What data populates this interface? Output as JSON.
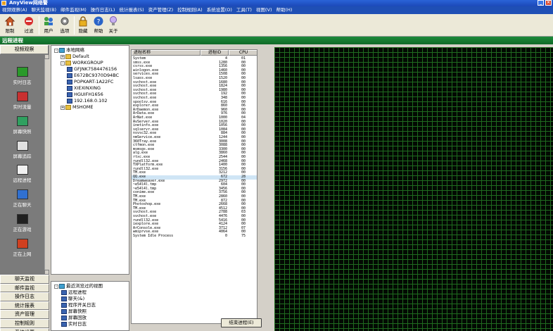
{
  "window": {
    "title": "AnyView网络警",
    "min": "_",
    "close": "×"
  },
  "menu": [
    "视频观察(A)",
    "聊天监视(B)",
    "邮件监视(M)",
    "操作日志(L)",
    "统计报表(S)",
    "资产管理(Z)",
    "控制规则(A)",
    "系统设置(O)",
    "工具(T)",
    "视图(V)",
    "帮助(H)"
  ],
  "toolbar": [
    {
      "label": "限制",
      "icon": "home-icon"
    },
    {
      "label": "过滤",
      "icon": "filter-icon"
    },
    {
      "label": "用户",
      "icon": "users-icon"
    },
    {
      "label": "选项",
      "icon": "options-icon"
    },
    {
      "label": "隐藏",
      "icon": "lock-icon"
    },
    {
      "label": "帮助",
      "icon": "help-icon"
    },
    {
      "label": "关于",
      "icon": "about-icon"
    }
  ],
  "section_title": "远程进程",
  "nav": {
    "header": "视频观察",
    "tiles": [
      {
        "label": "实时日志",
        "icon": "realtime-log-icon",
        "color": "#2a9a2a"
      },
      {
        "label": "实时流量",
        "icon": "traffic-icon",
        "color": "#c83030"
      },
      {
        "label": "屏幕快照",
        "icon": "screenshot-icon",
        "color": "#30a060"
      },
      {
        "label": "屏幕追踪",
        "icon": "screen-track-icon",
        "color": "#e0e0e0"
      },
      {
        "label": "远程进程",
        "icon": "remote-process-icon",
        "color": "#f0f0f0"
      },
      {
        "label": "正在聊天",
        "icon": "chat-icon",
        "color": "#3070d0"
      },
      {
        "label": "正在游戏",
        "icon": "game-icon",
        "color": "#202020"
      },
      {
        "label": "正在上网",
        "icon": "browse-icon",
        "color": "#d04020"
      }
    ],
    "bottom": [
      "聊天监视",
      "邮件监视",
      "操作日志",
      "统计报表",
      "资产管理",
      "控制规则",
      "系统设置"
    ]
  },
  "tree": [
    {
      "label": "本地网络",
      "depth": 0,
      "toggle": "-",
      "icon": "net"
    },
    {
      "label": "Default",
      "depth": 1,
      "toggle": "+",
      "icon": "folder"
    },
    {
      "label": "WORKGROUP",
      "depth": 1,
      "toggle": "-",
      "icon": "folder"
    },
    {
      "label": "GFJNK7584476156",
      "depth": 2,
      "toggle": "",
      "icon": "pc"
    },
    {
      "label": "E672BC9370D94BC",
      "depth": 2,
      "toggle": "",
      "icon": "pc"
    },
    {
      "label": "POPKART-1A22FC",
      "depth": 2,
      "toggle": "",
      "icon": "pc"
    },
    {
      "label": "XIEXINXING",
      "depth": 2,
      "toggle": "",
      "icon": "pc"
    },
    {
      "label": "HGUIFH1656",
      "depth": 2,
      "toggle": "",
      "icon": "pc"
    },
    {
      "label": "192.168.0.102",
      "depth": 2,
      "toggle": "",
      "icon": "pc"
    },
    {
      "label": "MSHOME",
      "depth": 1,
      "toggle": "+",
      "icon": "folder"
    }
  ],
  "views": {
    "title": "最近浏览过的视图",
    "items": [
      "远程进程",
      "聊天(&)",
      "程序开关日志",
      "屏幕快照",
      "屏幕回放",
      "实时日志"
    ]
  },
  "process_table": {
    "headers": [
      "进程名称",
      "进程ID",
      "CPU"
    ],
    "rows": [
      [
        "System",
        "4",
        "01"
      ],
      [
        "smss.exe",
        "1280",
        "00"
      ],
      [
        "csrss.exe",
        "1356",
        "00"
      ],
      [
        "winlogon.exe",
        "1460",
        "00"
      ],
      [
        "services.exe",
        "1508",
        "00"
      ],
      [
        "lsass.exe",
        "1520",
        "00"
      ],
      [
        "svchost.exe",
        "1680",
        "00"
      ],
      [
        "svchost.exe",
        "1824",
        "00"
      ],
      [
        "svchost.exe",
        "1980",
        "00"
      ],
      [
        "svchost.exe",
        "192",
        "00"
      ],
      [
        "svchost.exe",
        "348",
        "00"
      ],
      [
        "spoolsv.exe",
        "616",
        "00"
      ],
      [
        "explorer.exe",
        "860",
        "06"
      ],
      [
        "ArDaemon.exe",
        "960",
        "00"
      ],
      [
        "ArData.exe",
        "976",
        "00"
      ],
      [
        "ArNat.exe",
        "1000",
        "04"
      ],
      [
        "AvServer.exe",
        "1020",
        "00"
      ],
      [
        "inetinfo.exe",
        "1056",
        "00"
      ],
      [
        "sqlservr.exe",
        "1084",
        "00"
      ],
      [
        "nsvsc32.exe",
        "884",
        "00"
      ],
      [
        "nmService.exe",
        "1244",
        "00"
      ],
      [
        "360Tray.exe",
        "3008",
        "00"
      ],
      [
        "ctfmon.exe",
        "3088",
        "00"
      ],
      [
        "msmsgs.exe",
        "3300",
        "00"
      ],
      [
        "alg.exe",
        "3860",
        "00"
      ],
      [
        "rtxc.exe",
        "2544",
        "00"
      ],
      [
        "rundll32.exe",
        "2468",
        "00"
      ],
      [
        "TXPlatform.exe",
        "1400",
        "00"
      ],
      [
        "rundll32.exe",
        "3156",
        "00"
      ],
      [
        "TM.exe",
        "3212",
        "00"
      ],
      [
        "QQ.exe",
        "672",
        "28"
      ],
      [
        "Dreamweaver.exe",
        "2972",
        "00"
      ],
      [
        "~e54l4l.tmp",
        "604",
        "00"
      ],
      [
        "~e54l4l.tmp",
        "3456",
        "00"
      ],
      [
        "conime.exe",
        "3756",
        "00"
      ],
      [
        "TM.exe",
        "2860",
        "00"
      ],
      [
        "TM.exe",
        "872",
        "00"
      ],
      [
        "Photoshop.exe",
        "2668",
        "00"
      ],
      [
        "TM.exe",
        "4512",
        "00"
      ],
      [
        "svchost.exe",
        "2788",
        "03"
      ],
      [
        "svchost.exe",
        "4476",
        "00"
      ],
      [
        "rundll32.exe",
        "5416",
        "00"
      ],
      [
        "iexplore.exe",
        "4124",
        "00"
      ],
      [
        "ArConsole.exe",
        "3712",
        "07"
      ],
      [
        "wmiprvse.exe",
        "4064",
        "00"
      ],
      [
        "System Idle Process",
        "0",
        "75"
      ]
    ],
    "selected_row": 30,
    "end_button": "结束进程(E)"
  },
  "colors": {
    "titlebar": "#1c48b8",
    "menubar": "#1f4fb5",
    "section": "#0f6a28",
    "grid_line": "#1f6a1f",
    "screen_bg": "#030a03",
    "selected_row": "#cfe5f5"
  }
}
